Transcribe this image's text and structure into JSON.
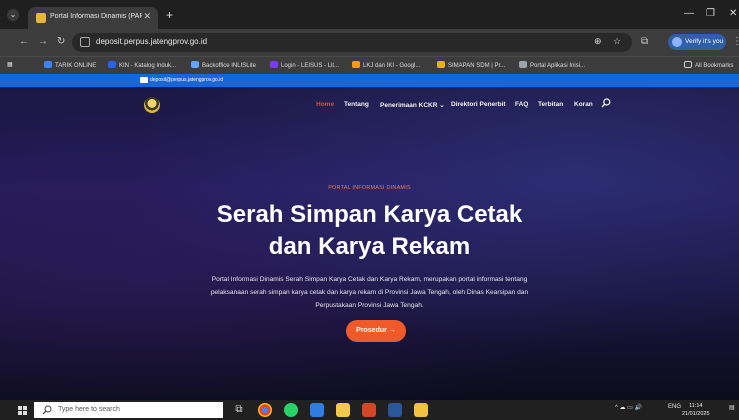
{
  "browser": {
    "tab_title": "Portal Informasi Dinamis (PARIS",
    "url": "deposit.perpus.jatengprov.go.id",
    "verify_label": "Verify it's you",
    "all_bookmarks": "All Bookmarks",
    "bookmarks": [
      {
        "label": "TARIK ONLINE",
        "color": "#3b82f6"
      },
      {
        "label": "KIN - Katalog Induk...",
        "color": "#2563eb"
      },
      {
        "label": "Backoffice INLISLite",
        "color": "#60a5fa"
      },
      {
        "label": "Login - LEISUS - Lit...",
        "color": "#7c3aed"
      },
      {
        "label": "LKJ dan IKI - Googl...",
        "color": "#f59e0b"
      },
      {
        "label": "SIMAPAN SDM | Pr...",
        "color": "#eab308"
      },
      {
        "label": "Portal Aplikasi Inisi...",
        "color": "#9ca3af"
      }
    ]
  },
  "site": {
    "email": "deposit@perpus.jatengprov.go.id",
    "nav": [
      "Home",
      "Tentang",
      "Penerimaan KCKR ⌄",
      "Direktori Penerbit",
      "FAQ",
      "Terbitan",
      "Koran"
    ],
    "tagline": "PORTAL INFORMASI DINAMIS",
    "title_line1": "Serah Simpan Karya Cetak",
    "title_line2": "dan Karya Rekam",
    "desc_line1": "Portal Informasi Dinamis Serah Simpan Karya Cetak dan Karya Rekam, merupakan portal informasi tentang",
    "desc_line2": "pelaksanaan serah simpan karya cetak dan karya rekam di Provinsi Jawa Tengah, oleh Dinas Kearsipan dan",
    "desc_line3": "Perpustakaan Provinsi Jawa Tengah.",
    "cta": "Prosedur →"
  },
  "taskbar": {
    "search_placeholder": "Type here to search",
    "lang": "ENG",
    "time": "11:14",
    "date": "21/01/2025"
  }
}
